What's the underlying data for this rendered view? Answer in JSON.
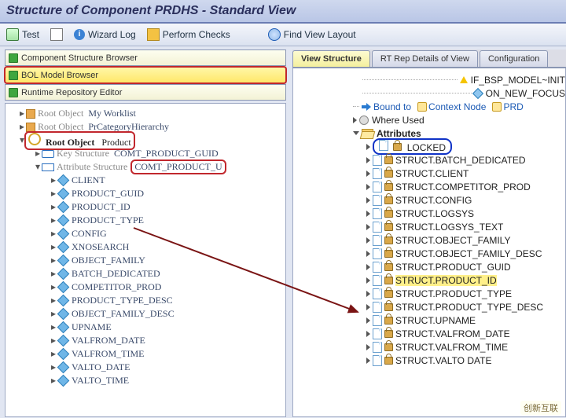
{
  "title": "Structure of Component PRDHS - Standard View",
  "toolbar": {
    "test": "Test",
    "wizard_log": "Wizard Log",
    "perform_checks": "Perform Checks",
    "find_layout": "Find View Layout"
  },
  "left_panels": {
    "comp_struct": "Component Structure Browser",
    "bol_model": "BOL Model Browser",
    "runtime_repo": "Runtime Repository Editor"
  },
  "tree": {
    "root_label": "Root Object",
    "worklist": "My Worklist",
    "pr_cat": "PrCategoryHierarchy",
    "product": "Product",
    "key_struct_label": "Key Structure",
    "key_struct_val": "COMT_PRODUCT_GUID",
    "attr_struct_label": "Attribute Structure",
    "attr_struct_val": "COMT_PRODUCT_U",
    "attrs": [
      "CLIENT",
      "PRODUCT_GUID",
      "PRODUCT_ID",
      "PRODUCT_TYPE",
      "CONFIG",
      "XNOSEARCH",
      "OBJECT_FAMILY",
      "BATCH_DEDICATED",
      "COMPETITOR_PROD",
      "PRODUCT_TYPE_DESC",
      "OBJECT_FAMILY_DESC",
      "UPNAME",
      "VALFROM_DATE",
      "VALFROM_TIME",
      "VALTO_DATE",
      "VALTO_TIME"
    ]
  },
  "tabs": {
    "view_structure": "View Structure",
    "rt_rep": "RT Rep Details of View",
    "config": "Configuration"
  },
  "right": {
    "if_bsp": "IF_BSP_MODEL~INIT",
    "on_new_focus": "ON_NEW_FOCUS",
    "bound_to": "Bound to",
    "context_node": "Context Node",
    "prd": "PRD",
    "where_used": "Where Used",
    "attributes": "Attributes",
    "locked": "LOCKED",
    "struct": [
      "STRUCT.BATCH_DEDICATED",
      "STRUCT.CLIENT",
      "STRUCT.COMPETITOR_PROD",
      "STRUCT.CONFIG",
      "STRUCT.LOGSYS",
      "STRUCT.LOGSYS_TEXT",
      "STRUCT.OBJECT_FAMILY",
      "STRUCT.OBJECT_FAMILY_DESC",
      "STRUCT.PRODUCT_GUID",
      "STRUCT.PRODUCT_ID",
      "STRUCT.PRODUCT_TYPE",
      "STRUCT.PRODUCT_TYPE_DESC",
      "STRUCT.UPNAME",
      "STRUCT.VALFROM_DATE",
      "STRUCT.VALFROM_TIME",
      "STRUCT.VALTO DATE"
    ]
  },
  "brand": "创新互联"
}
